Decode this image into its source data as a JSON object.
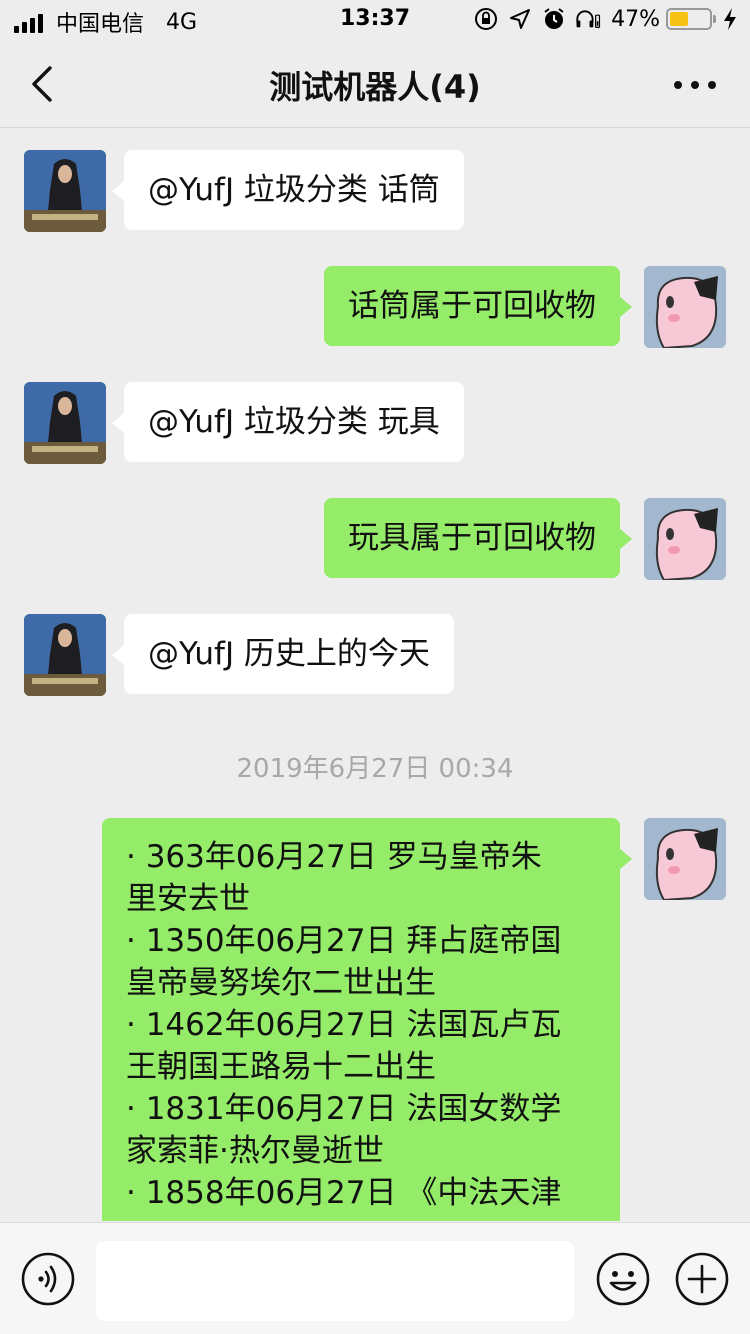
{
  "status_bar": {
    "carrier": "中国电信",
    "network": "4G",
    "time": "13:37",
    "battery_percent_label": "47%",
    "battery_level": 0.47
  },
  "nav": {
    "title": "测试机器人(4)"
  },
  "messages": [
    {
      "from": "bot",
      "text": "@YufJ 垃圾分类 话筒"
    },
    {
      "from": "me",
      "text": "话筒属于可回收物"
    },
    {
      "from": "bot",
      "text": "@YufJ 垃圾分类 玩具"
    },
    {
      "from": "me",
      "text": "玩具属于可回收物"
    },
    {
      "from": "bot",
      "text": "@YufJ 历史上的今天"
    }
  ],
  "timestamp": "2019年6月27日 00:34",
  "history_message": {
    "from": "me",
    "lines": [
      "· 363年06月27日 罗马皇帝朱",
      "里安去世",
      "· 1350年06月27日 拜占庭帝国",
      "皇帝曼努埃尔二世出生",
      "· 1462年06月27日 法国瓦卢瓦",
      "王朝国王路易十二出生",
      "· 1831年06月27日 法国女数学",
      "家索菲·热尔曼逝世",
      "· 1858年06月27日 《中法天津"
    ]
  },
  "input": {
    "value": "",
    "placeholder": ""
  },
  "icons": {
    "back": "chevron-left-icon",
    "more": "more-dots-icon",
    "voice": "voice-icon",
    "emoji": "emoji-icon",
    "plus": "plus-icon"
  },
  "colors": {
    "outgoing_bubble": "#95ec69",
    "incoming_bubble": "#ffffff",
    "background": "#ededed",
    "battery": "#f6c314"
  }
}
